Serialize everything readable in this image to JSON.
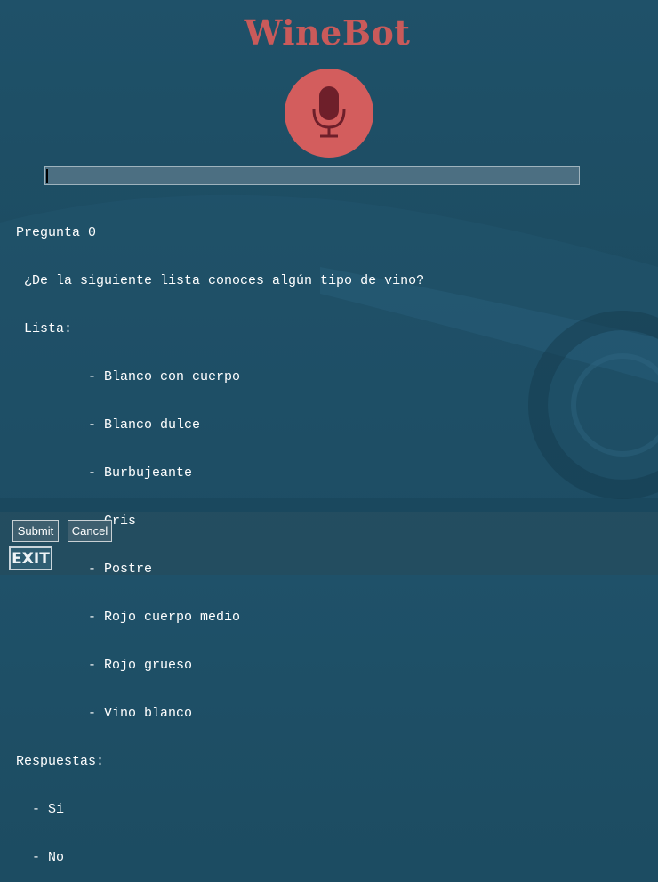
{
  "app": {
    "title": "WineBot"
  },
  "mic": {
    "icon": "microphone-icon",
    "bg_color": "#d35d5d",
    "icon_color": "#6e1f2a"
  },
  "input": {
    "value": "",
    "placeholder": ""
  },
  "output": {
    "question_header": "Pregunta 0",
    "question_text": " ¿De la siguiente lista conoces algún tipo de vino?",
    "list_header": " Lista:",
    "list_items": [
      "         - Blanco con cuerpo",
      "         - Blanco dulce",
      "         - Burbujeante",
      "         - Gris",
      "         - Postre",
      "         - Rojo cuerpo medio",
      "         - Rojo grueso",
      "         - Vino blanco"
    ],
    "answers_header": "Respuestas:",
    "answers": [
      "  - Si",
      "  - No"
    ]
  },
  "buttons": {
    "submit_label": "Submit",
    "cancel_label": "Cancel",
    "exit_label": "EXIT"
  },
  "colors": {
    "title": "#c95a5a",
    "background": "#1d4d63"
  }
}
